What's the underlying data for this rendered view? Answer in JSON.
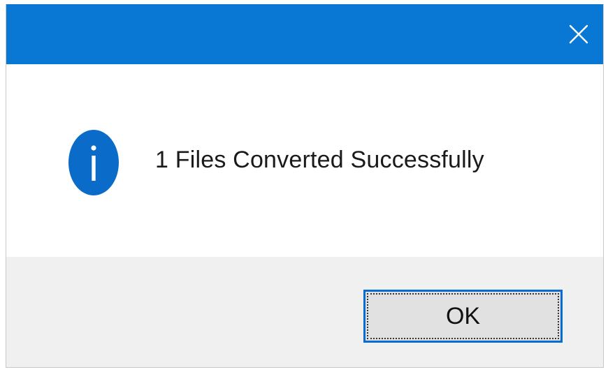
{
  "dialog": {
    "close_icon": "close-icon",
    "info_icon": "information-icon",
    "message": "1 Files Converted Successfully",
    "ok_label": "OK"
  },
  "colors": {
    "titlebar": "#0978d4",
    "info_icon": "#0a6cc8",
    "footer": "#f0f0f0",
    "button_border": "#0a6cd2"
  }
}
